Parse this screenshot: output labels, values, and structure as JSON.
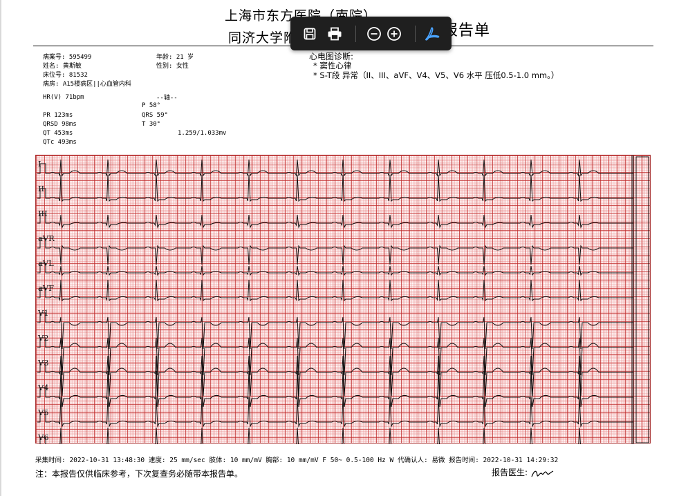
{
  "header": {
    "hospital_line1": "上海市东方医院（南院）",
    "hospital_line2": "同济大学附",
    "report_title": "报告单"
  },
  "patient": {
    "case_no": "病案号: 595499",
    "name": "姓名: 黄斯敏",
    "bed": "床位号:   81532",
    "ward": "病房: A15楼病区||心血管内科",
    "age": "年龄: 21 岁",
    "sex": "性别: 女性"
  },
  "measurements": {
    "hr": "HR(V)    71bpm",
    "axis_header": "--轴--",
    "pr": "PR       123ms",
    "qrsd": "QRSD      98ms",
    "qt": "QT       453ms",
    "qtc": "QTc      493ms",
    "p_axis": "P              58°",
    "qrs_axis": "QRS            59°",
    "t_axis": "T              30°",
    "voltage": "1.259/1.033mv"
  },
  "diagnosis": {
    "title": "心电图诊断:",
    "lines": [
      "* 窦性心律",
      "* S-T段 异常（II、III、aVF、V4、V5、V6 水平 压低0.5-1.0 mm。）"
    ]
  },
  "leads": [
    "I",
    "II",
    "III",
    "aVR",
    "aVL",
    "aVF",
    "V1",
    "V2",
    "V3",
    "V4",
    "V5",
    "V6"
  ],
  "footer": {
    "acquisition": "采集时间: 2022-10-31 13:48:30    速度: 25 mm/sec  肢体: 10 mm/mV  胸部: 10 mm/mV  F 50~ 0.5-100 Hz W  代确认人: 易微  报告时间: 2022-10-31 14:29:32",
    "note": "注：本报告仅供临床参考，下次复查务必随带本报告单。",
    "doctor_label": "报告医生:"
  },
  "toolbar": {
    "items": [
      "save-icon",
      "print-icon",
      "zoom-out-icon",
      "zoom-in-icon",
      "acrobat-icon"
    ],
    "accent_color": "#4aa3ff"
  },
  "ecg": {
    "heart_rate_bpm": 71,
    "paper_speed_mm_per_sec": 25,
    "limb_gain_mm_per_mv": 10,
    "chest_gain_mm_per_mv": 10
  }
}
